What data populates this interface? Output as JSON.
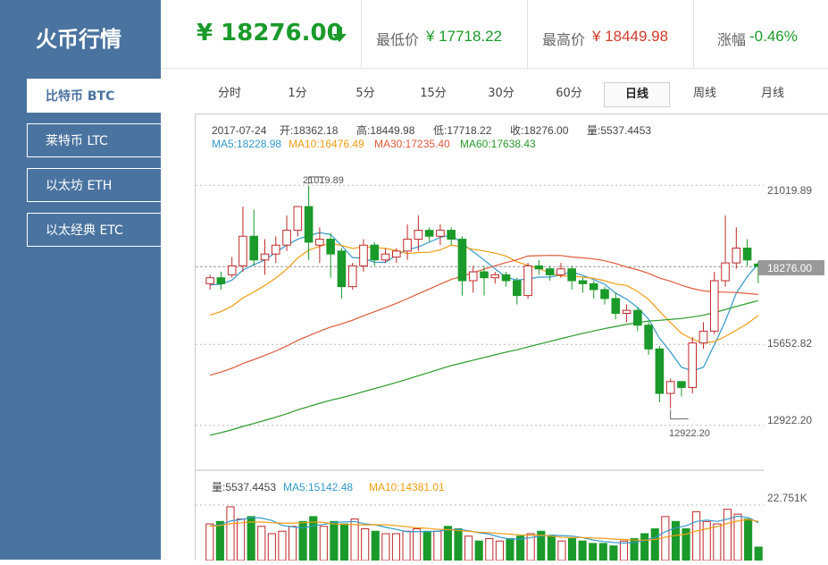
{
  "app": {
    "logo": "火币行情"
  },
  "sidebar": {
    "coins": [
      {
        "label": "比特币 BTC",
        "active": true
      },
      {
        "label": "莱特币 LTC",
        "active": false
      },
      {
        "label": "以太坊 ETH",
        "active": false
      },
      {
        "label": "以太经典 ETC",
        "active": false
      }
    ]
  },
  "ticker": {
    "price": "¥ 18276.00",
    "direction": "down",
    "low_label": "最低价",
    "low_value": "¥ 17718.22",
    "high_label": "最高价",
    "high_value": "¥ 18449.98",
    "change_label": "涨幅",
    "change_value": "-0.46%"
  },
  "tabs": [
    {
      "label": "分时",
      "active": false
    },
    {
      "label": "1分",
      "active": false
    },
    {
      "label": "5分",
      "active": false
    },
    {
      "label": "15分",
      "active": false
    },
    {
      "label": "30分",
      "active": false
    },
    {
      "label": "60分",
      "active": false
    },
    {
      "label": "日线",
      "active": true
    },
    {
      "label": "周线",
      "active": false
    },
    {
      "label": "月线",
      "active": false
    }
  ],
  "colors": {
    "sidebar": "#4a73a0",
    "up": "#c0282a",
    "down": "#1a9a2a",
    "ma5": "#3399cc",
    "ma10": "#f39c12",
    "ma30": "#e05a3a",
    "ma60": "#2a9a2a"
  },
  "chart_data": {
    "type": "candlestick",
    "info": {
      "date": "2017-07-24",
      "open": "开:18362.18",
      "high": "高:18449.98",
      "low": "低:17718.22",
      "close": "收:18276.00",
      "volume": "量:5537.4453"
    },
    "ma_legend": [
      {
        "label": "MA5:18228.98",
        "color": "#3399cc"
      },
      {
        "label": "MA10:16476.49",
        "color": "#f39c12"
      },
      {
        "label": "MA30:17235.40",
        "color": "#e05a3a"
      },
      {
        "label": "MA60:17638.43",
        "color": "#2a9a2a"
      }
    ],
    "y_ticks": [
      "21019.89",
      "15652.82",
      "12922.20"
    ],
    "last_price_label": "18276.00",
    "max_annotation": "21019.89",
    "min_annotation": "12922.20",
    "ylim": [
      11500,
      21900
    ],
    "candles": [
      [
        17700,
        17900,
        17500,
        18000
      ],
      [
        17900,
        17700,
        17500,
        18100
      ],
      [
        18000,
        18300,
        17900,
        18600
      ],
      [
        18300,
        19300,
        18100,
        20300
      ],
      [
        19300,
        18500,
        18300,
        20200
      ],
      [
        18500,
        18700,
        18000,
        19200
      ],
      [
        18700,
        19000,
        18400,
        19300
      ],
      [
        19000,
        19500,
        18800,
        20000
      ],
      [
        19500,
        20300,
        19300,
        20300
      ],
      [
        20300,
        19100,
        18500,
        21000
      ],
      [
        19000,
        19200,
        18400,
        19600
      ],
      [
        19200,
        18700,
        17900,
        19400
      ],
      [
        18800,
        17600,
        17200,
        18900
      ],
      [
        17600,
        18300,
        17500,
        18400
      ],
      [
        18300,
        19000,
        18100,
        19200
      ],
      [
        19000,
        18500,
        18300,
        19100
      ],
      [
        18500,
        18700,
        18400,
        18900
      ],
      [
        18600,
        18800,
        18400,
        18900
      ],
      [
        18800,
        19200,
        18500,
        19700
      ],
      [
        19200,
        19500,
        18800,
        20000
      ],
      [
        19500,
        19300,
        19100,
        19600
      ],
      [
        19300,
        19500,
        19000,
        19700
      ],
      [
        19500,
        19200,
        19000,
        19600
      ],
      [
        19200,
        17800,
        17300,
        19300
      ],
      [
        17800,
        18100,
        17400,
        18300
      ],
      [
        18100,
        17900,
        17300,
        18300
      ],
      [
        17900,
        18000,
        17700,
        18100
      ],
      [
        18000,
        17800,
        17600,
        18100
      ],
      [
        17800,
        17300,
        17000,
        17900
      ],
      [
        17300,
        18300,
        17200,
        18400
      ],
      [
        18300,
        18200,
        18000,
        18500
      ],
      [
        18200,
        18000,
        17800,
        18300
      ],
      [
        18000,
        18200,
        17900,
        18400
      ],
      [
        18200,
        17800,
        17500,
        18300
      ],
      [
        17800,
        17700,
        17400,
        17900
      ],
      [
        17700,
        17500,
        17200,
        17800
      ],
      [
        17500,
        17200,
        17000,
        17600
      ],
      [
        17200,
        16700,
        16500,
        17400
      ],
      [
        16700,
        16800,
        16400,
        17000
      ],
      [
        16800,
        16300,
        16100,
        16900
      ],
      [
        16300,
        15500,
        15300,
        16400
      ],
      [
        15500,
        14000,
        13700,
        15600
      ],
      [
        14000,
        14400,
        13500,
        14500
      ],
      [
        14400,
        14200,
        13900,
        14400
      ],
      [
        14200,
        15700,
        14000,
        15900
      ],
      [
        15700,
        16100,
        15500,
        16400
      ],
      [
        16100,
        17800,
        16000,
        18100
      ],
      [
        17800,
        18400,
        17600,
        20000
      ],
      [
        18400,
        18900,
        18200,
        19600
      ],
      [
        18900,
        18500,
        18300,
        19200
      ],
      [
        18362,
        18276,
        17718,
        18450
      ]
    ],
    "volume": {
      "info": "量:5537.4453",
      "ma_legend": [
        {
          "label": "MA5:15142.48",
          "color": "#3399cc"
        },
        {
          "label": "MA10:14381.01",
          "color": "#f39c12"
        }
      ],
      "y_tick": "22.751K",
      "ylim": [
        0,
        26000
      ],
      "values": [
        15000,
        16000,
        22000,
        17000,
        18000,
        14000,
        11000,
        12000,
        14000,
        16000,
        18000,
        14000,
        16000,
        15000,
        17000,
        13000,
        12000,
        11000,
        11000,
        12000,
        13000,
        12000,
        12000,
        14000,
        13000,
        10000,
        8000,
        9000,
        8000,
        9000,
        10000,
        11000,
        12000,
        10000,
        8000,
        9000,
        8000,
        7000,
        7000,
        6000,
        8000,
        9000,
        11000,
        13000,
        18000,
        16000,
        13000,
        20000,
        16000,
        15000,
        21000,
        19000,
        17000,
        5500
      ]
    }
  }
}
